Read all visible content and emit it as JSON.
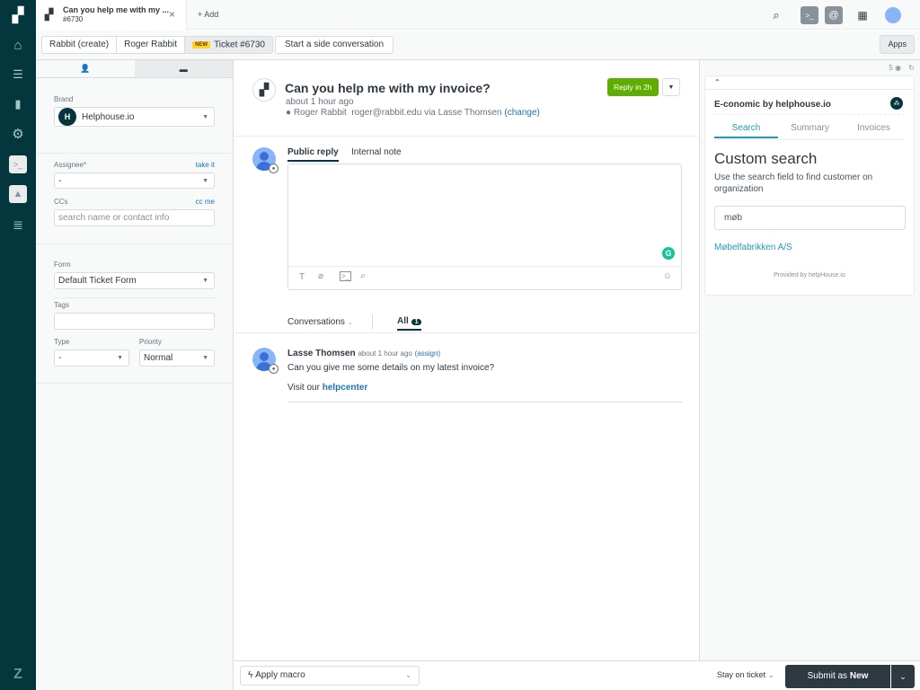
{
  "top_bar": {
    "tab_title": "Can you help me with my ...",
    "tab_subtitle": "#6730",
    "add_label": "Add"
  },
  "sub_bar": {
    "crumbs": [
      "Rabbit (create)",
      "Roger Rabbit",
      "Ticket #6730"
    ],
    "new_badge": "NEW",
    "side_conversation_label": "Start a side conversation",
    "apps_label": "Apps"
  },
  "left_panel": {
    "brand_label": "Brand",
    "brand_value": "Helphouse.io",
    "assignee_label": "Assignee*",
    "take_it": "take it",
    "assignee_value": "-",
    "ccs_label": "CCs",
    "cc_me": "cc me",
    "ccs_placeholder": "search name or contact info",
    "form_label": "Form",
    "form_value": "Default Ticket Form",
    "tags_label": "Tags",
    "type_label": "Type",
    "type_value": "-",
    "priority_label": "Priority",
    "priority_value": "Normal"
  },
  "ticket": {
    "subject": "Can you help me with my invoice?",
    "time": "about 1 hour ago",
    "requester": "Roger Rabbit",
    "email_via": "roger@rabbit.edu via Lasse Thomsen",
    "change_link": "(change)",
    "sla_badge": "Reply in 2h",
    "sla_color": "#5eae00"
  },
  "composer": {
    "tabs": [
      "Public reply",
      "Internal note"
    ],
    "active_tab": 0
  },
  "conversations": {
    "filter_label": "Conversations",
    "all_label": "All",
    "all_count": "1"
  },
  "comment": {
    "author": "Lasse Thomsen",
    "time": "about 1 hour ago",
    "assign_link": "(assign)",
    "body": "Can you give me some details on my latest invoice?",
    "visit_prefix": "Visit our",
    "visit_link": "helpcenter"
  },
  "app_panel": {
    "count": "5",
    "title": "E-conomic by helphouse.io",
    "tabs": [
      "Search",
      "Summary",
      "Invoices"
    ],
    "active_tab": 0,
    "heading": "Custom search",
    "description": "Use the search field to find customer on organization",
    "search_value": "møb",
    "result": "Møbelfabrikken A/S",
    "provided_by": "Provided by helpHouse.io",
    "accent": "#1f9bb5"
  },
  "footer": {
    "macro_label": "Apply macro",
    "stay_label": "Stay on ticket",
    "submit_prefix": "Submit as",
    "submit_status": "New"
  }
}
